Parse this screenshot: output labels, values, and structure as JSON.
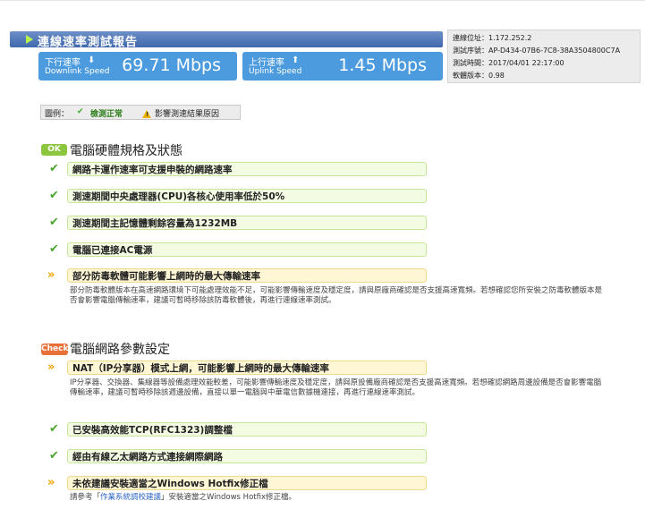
{
  "header": {
    "title": "連線速率測試報告"
  },
  "downlink": {
    "label_zh": "下行速率",
    "label_en": "Downlink Speed",
    "arrow": "⬇",
    "value": "69.71 Mbps"
  },
  "uplink": {
    "label_zh": "上行速率",
    "label_en": "Uplink Speed",
    "arrow": "⬆",
    "value": "1.45 Mbps"
  },
  "info": {
    "ip": "連線位址：1.172.252.2",
    "serial": "測試序號：AP-D434-07B6-7C8-38A3504800C7A",
    "time": "測試時間：2017/04/01 22:17:00",
    "version": "軟體版本：0.98"
  },
  "legend": {
    "label": "圖例：",
    "ok": "檢測正常",
    "warn": "影響測速結果原因"
  },
  "section1": {
    "badge": "OK",
    "title": "電腦硬體規格及狀態",
    "items": [
      "網路卡運作速率可支援申裝的網路速率",
      "測速期間中央處理器(CPU)各核心使用率低於50%",
      "測速期間主記憶體剩餘容量為1232MB",
      "電腦已連接AC電源"
    ],
    "warn_title": "部分防毒軟體可能影響上網時的最大傳輸速率",
    "warn_desc": "部分防毒軟體版本在高速網路環境下可能處理效能不足，可能影響傳輸速度及穩定度，請與原廠商確認是否支援高速寬頻。若想確認您所安裝之防毒軟體版本是否會影響電腦傳輸速率，建議可暫時移除該防毒軟體後，再進行連線速率測試。"
  },
  "section2": {
    "badge": "Check",
    "title": "電腦網路參數設定",
    "warn1_title": "NAT（IP分享器）模式上網，可能影響上網時的最大傳輸速率",
    "warn1_desc": "IP分享器、交換器、集線器等設備處理效能較差，可能影響傳輸速度及穩定度，請與原設備廠商確認是否支援高速寬頻。若想確認網路周邊設備是否會影響電腦傳輸速率，建議可暫時移除該週邊設備，直接以單一電腦與中華電信數據機連接，再進行連線速率測試。",
    "ok_items": [
      "已安裝高效能TCP(RFC1323)調整檔",
      "經由有線乙太網路方式連接網際網路"
    ],
    "warn2_title": "未依建議安裝適當之Windows Hotfix修正檔",
    "warn2_desc_pre": "請參考「",
    "warn2_link": "作業系統調校建議",
    "warn2_desc_post": "」安裝適當之Windows Hotfix修正檔。"
  }
}
